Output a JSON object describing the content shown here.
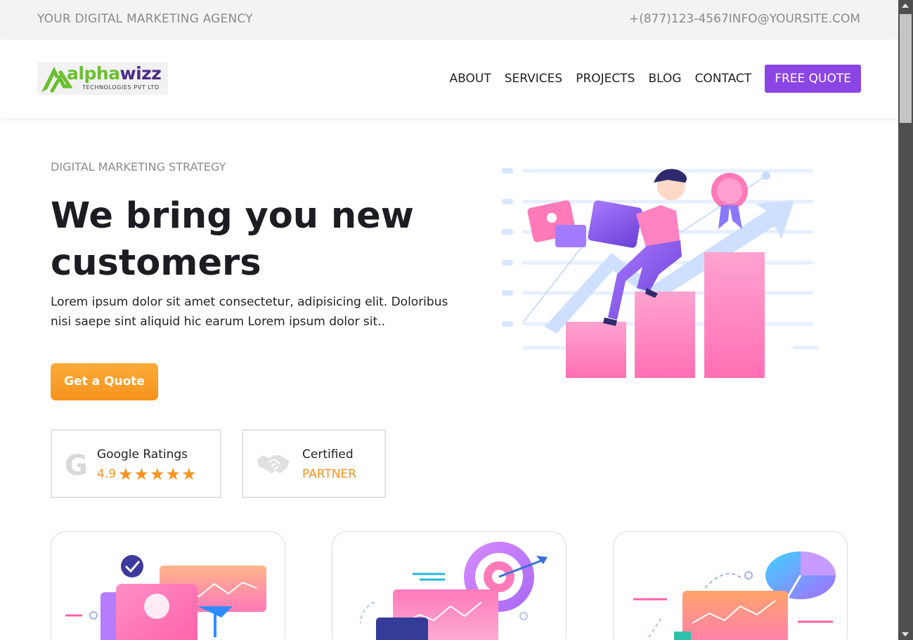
{
  "topbar": {
    "tagline": "YOUR DIGITAL MARKETING AGENCY",
    "contact": "+(877)123-4567INFO@YOURSITE.COM"
  },
  "logo": {
    "word_part1": "alpha",
    "word_part2": "wizz",
    "subtitle": "TECHNOLOGIES PVT LTD"
  },
  "nav": {
    "items": [
      "ABOUT",
      "SERVICES",
      "PROJECTS",
      "BLOG",
      "CONTACT"
    ],
    "quote_button": "FREE QUOTE"
  },
  "hero": {
    "eyebrow": "DIGITAL MARKETING STRATEGY",
    "headline": "We bring you new customers",
    "description": "Lorem ipsum dolor sit amet consectetur, adipisicing elit. Doloribus nisi saepe sint aliquid hic earum Lorem ipsum dolor sit..",
    "cta": "Get a Quote"
  },
  "badges": {
    "google": {
      "icon": "google-g-icon",
      "title": "Google Ratings",
      "rating": "4.9",
      "stars": "★★★★★"
    },
    "partner": {
      "icon": "handshake-icon",
      "title": "Certified",
      "subtitle": "PARTNER"
    }
  },
  "colors": {
    "accent_purple": "#8b45e4",
    "accent_orange": "#f7931e",
    "pink": "#ff7ab9",
    "logo_green": "#6abf2f"
  }
}
